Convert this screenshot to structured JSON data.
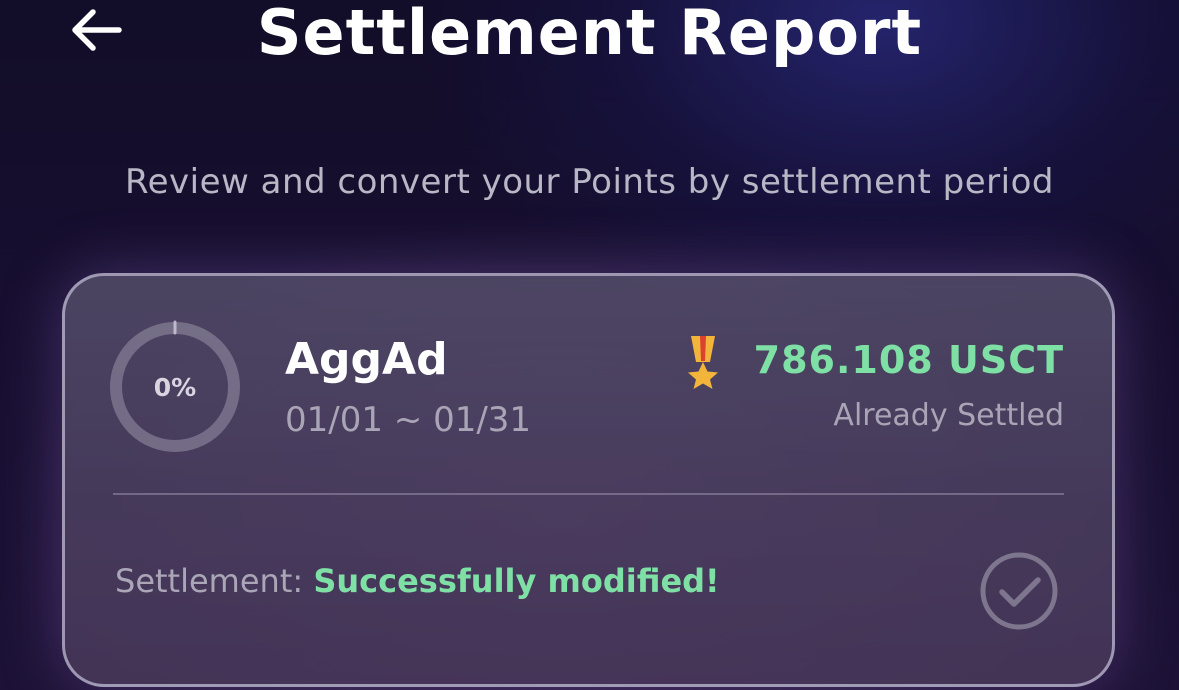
{
  "header": {
    "title": "Settlement Report",
    "back_icon": "arrow-left-icon"
  },
  "subtitle": "Review and convert your Points by settlement period",
  "card": {
    "progress": {
      "label": "0%",
      "fraction": 0
    },
    "campaign_name": "AggAd",
    "date_range": "01/01 ~ 01/31",
    "medal_icon": "medal-icon",
    "amount": "786.108 USCT",
    "amount_status": "Already Settled",
    "settlement_label": "Settlement: ",
    "settlement_value": "Successfully modified!",
    "status_icon": "check-circle-icon"
  },
  "colors": {
    "accent_green": "#7fe0a6",
    "muted_text": "#a9a5b6",
    "medal_gold": "#f2b43a",
    "background": "#140e2c"
  }
}
